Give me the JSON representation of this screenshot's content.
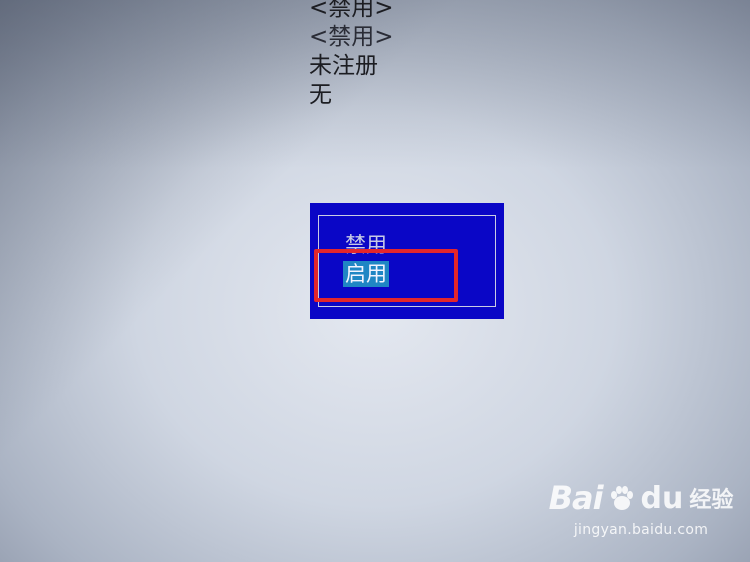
{
  "bios_values": {
    "lines": [
      "<禁用>",
      "<禁用>",
      "未注册",
      "无"
    ]
  },
  "popup": {
    "options": [
      "禁用",
      "启用"
    ],
    "selected_index": 1,
    "background_color": "#0a06c6",
    "selection_color": "#1f86c4"
  },
  "annotation": {
    "highlight_color": "#e3262b"
  },
  "watermark": {
    "brand_bai": "Bai",
    "brand_du": "du",
    "brand_jingyan": "经验",
    "url": "jingyan.baidu.com",
    "paw_icon": "baidu-paw-icon"
  }
}
